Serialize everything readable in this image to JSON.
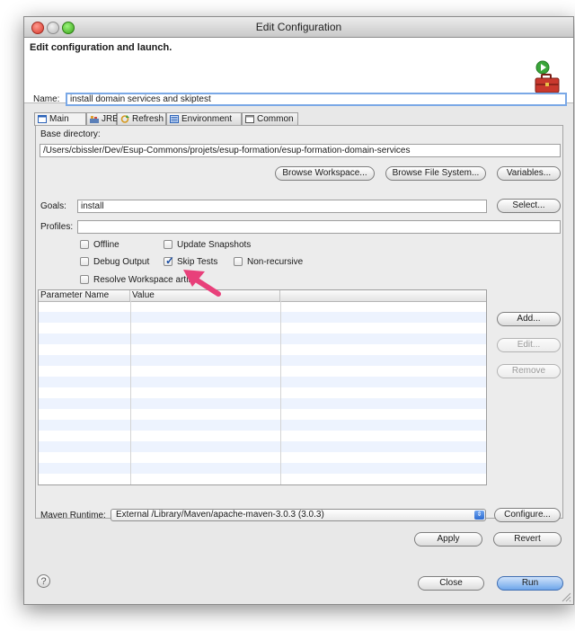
{
  "window": {
    "title": "Edit Configuration"
  },
  "banner": {
    "title": "Edit configuration and launch."
  },
  "name": {
    "label": "Name:",
    "value": "install domain services and skiptest"
  },
  "tabs": [
    {
      "label": "Main",
      "icon": "main-tab-icon"
    },
    {
      "label": "JRE",
      "icon": "jre-icon"
    },
    {
      "label": "Refresh",
      "icon": "refresh-icon"
    },
    {
      "label": "Environment",
      "icon": "environment-icon"
    },
    {
      "label": "Common",
      "icon": "common-icon"
    }
  ],
  "main": {
    "base_dir_label": "Base directory:",
    "base_dir_value": "/Users/cbissler/Dev/Esup-Commons/projets/esup-formation/esup-formation-domain-services",
    "browse_workspace": "Browse Workspace...",
    "browse_fs": "Browse File System...",
    "variables": "Variables...",
    "goals_label": "Goals:",
    "goals_value": "install",
    "select": "Select...",
    "profiles_label": "Profiles:",
    "profiles_value": "",
    "checkboxes": {
      "offline": {
        "label": "Offline",
        "checked": false
      },
      "update_snapshots": {
        "label": "Update Snapshots",
        "checked": false
      },
      "debug_output": {
        "label": "Debug Output",
        "checked": false
      },
      "skip_tests": {
        "label": "Skip Tests",
        "checked": true
      },
      "non_recursive": {
        "label": "Non-recursive",
        "checked": false
      },
      "resolve_workspace": {
        "label": "Resolve Workspace artifa",
        "checked": false
      }
    },
    "table": {
      "col_name": "Parameter Name",
      "col_value": "Value",
      "rows": []
    },
    "add": "Add...",
    "edit": "Edit...",
    "remove": "Remove",
    "maven_runtime_label": "Maven Runtime:",
    "maven_runtime_value": "External /Library/Maven/apache-maven-3.0.3 (3.0.3)",
    "configure": "Configure...",
    "apply": "Apply",
    "revert": "Revert"
  },
  "footer": {
    "help": "?",
    "close": "Close",
    "run": "Run"
  },
  "colors": {
    "accent": "#4a86e0",
    "annotation_arrow": "#e8407a",
    "table_alt_row": "#edf3fe"
  }
}
